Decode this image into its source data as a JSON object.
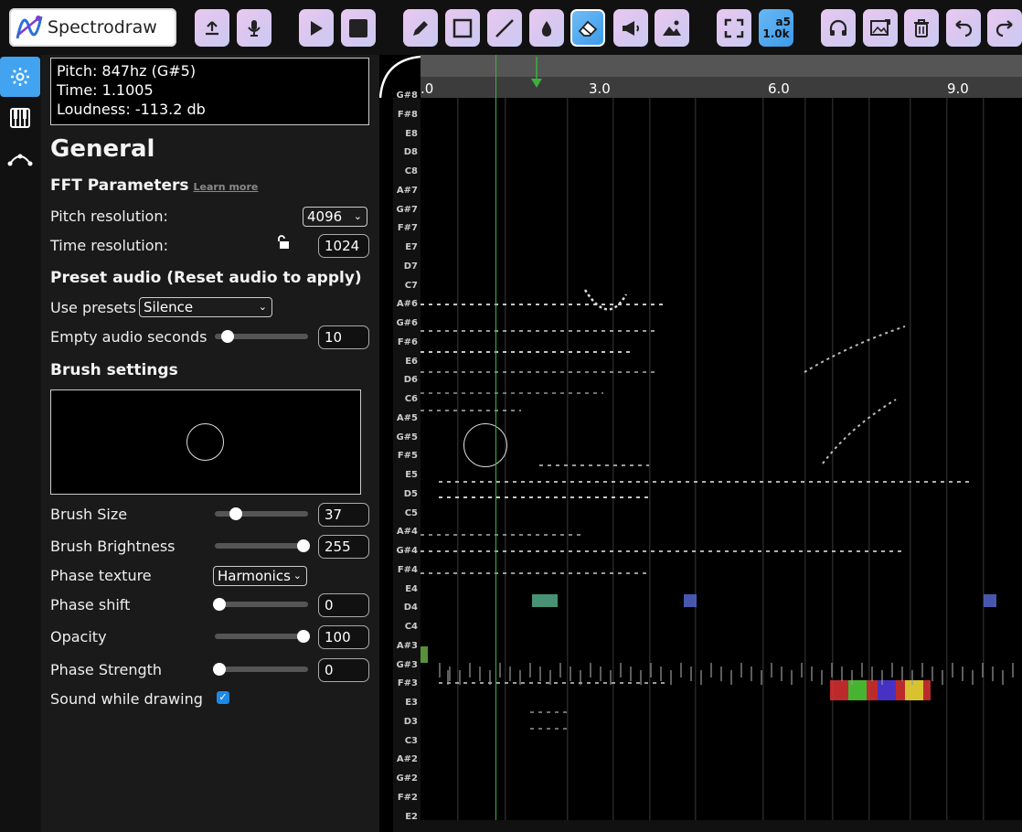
{
  "app": {
    "name": "Spectrodraw"
  },
  "toolbar": {
    "buttons": [
      "upload-icon",
      "microphone-icon",
      "play-icon",
      "stop-icon",
      "pencil-icon",
      "rectangle-icon",
      "line-icon",
      "droplet-icon",
      "eraser-icon",
      "megaphone-icon",
      "image-icon",
      "fullscreen-icon",
      "note-frequency-icon",
      "headphones-icon",
      "image-export-icon",
      "trash-icon",
      "undo-icon",
      "redo-icon"
    ],
    "note_badge_top": "a5",
    "note_badge_bottom": "1.0k",
    "active_tool": "eraser",
    "colors": {
      "button_gradient_start": "#e9c8f1",
      "button_gradient_end": "#c9cbf4",
      "active_blue": "#3d9ae9"
    }
  },
  "rail": [
    "gear-icon",
    "piano-icon",
    "curve-icon"
  ],
  "info": {
    "pitch": "Pitch: 847hz (G#5)",
    "time": "Time: 1.1005",
    "loudness": "Loudness: -113.2 db"
  },
  "general": {
    "title": "General",
    "fft_heading": "FFT Parameters",
    "learn_more": "Learn more",
    "pitch_resolution_label": "Pitch resolution:",
    "pitch_resolution_value": "4096",
    "time_resolution_label": "Time resolution:",
    "time_resolution_value": "1024",
    "preset_heading": "Preset audio (Reset audio to apply)",
    "use_presets_label": "Use presets",
    "use_presets_value": "Silence",
    "empty_audio_label": "Empty audio seconds",
    "empty_audio_value": "10",
    "empty_audio_fraction": 0.1,
    "brush_heading": "Brush settings"
  },
  "brush": {
    "size_label": "Brush Size",
    "size_value": "37",
    "size_fraction": 0.2,
    "brightness_label": "Brush Brightness",
    "brightness_value": "255",
    "brightness_fraction": 1.0,
    "phase_texture_label": "Phase texture",
    "phase_texture_value": "Harmonics",
    "phase_shift_label": "Phase shift",
    "phase_shift_value": "0",
    "phase_shift_fraction": 0,
    "opacity_label": "Opacity",
    "opacity_value": "100",
    "opacity_fraction": 1.0,
    "phase_strength_label": "Phase Strength",
    "phase_strength_value": "0",
    "phase_strength_fraction": 0,
    "sound_while_drawing_label": "Sound while drawing",
    "sound_while_drawing_checked": true
  },
  "timeline": {
    "ticks": [
      ".0",
      "3.0",
      "6.0",
      "9.0"
    ],
    "playhead_time": 1.1005
  },
  "notes": [
    "G#8",
    "F#8",
    "E8",
    "D8",
    "C8",
    "A#7",
    "G#7",
    "F#7",
    "E7",
    "D7",
    "C7",
    "A#6",
    "G#6",
    "F#6",
    "E6",
    "D6",
    "C6",
    "A#5",
    "G#5",
    "F#5",
    "E5",
    "D5",
    "C5",
    "A#4",
    "G#4",
    "F#4",
    "E4",
    "D4",
    "C4",
    "A#3",
    "G#3",
    "F#3",
    "E3",
    "D3",
    "C3",
    "A#2",
    "G#2",
    "F#2",
    "E2"
  ]
}
